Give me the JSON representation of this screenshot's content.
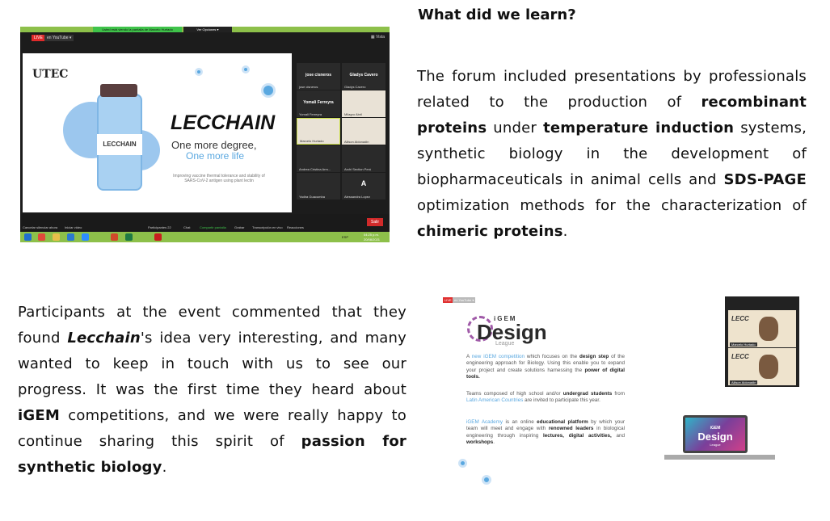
{
  "heading": "What did we learn?",
  "right_paragraph": {
    "parts": [
      "The forum included presentations by professionals related to the production of ",
      "recombinant proteins",
      " under ",
      "temperature induction",
      " systems, synthetic biology in the development of biopharmaceuticals in animal cells and ",
      "SDS-PAGE",
      " optimization methods for the characterization of ",
      "chimeric proteins",
      "."
    ]
  },
  "left_paragraph": {
    "parts": [
      "Participants at the event commented that they found ",
      "Lecchain",
      "'s idea very interesting, and many wanted to keep in touch with us to see our progress. It was the first time they heard about ",
      "iGEM",
      " competitions, and we were really happy to continue sharing this spirit of ",
      "passion for synthetic biology",
      "."
    ]
  },
  "zoom_screenshot": {
    "banner": "Usted está viendo la pantalla de Marcelo Hurtado",
    "options": "Ver Opciones ▾",
    "live": "LIVE",
    "youtube": "en YouTube ▾",
    "view": "▦ Vista",
    "slide": {
      "logo": "UTEC",
      "title": "LECCHAIN",
      "vial_label": "LECCHAIN",
      "tagline1": "One more degree,",
      "tagline2": "One more life",
      "subtitle": "Improving vaccine thermal tolerance and stability of SARS-CoV-2 antigen using plant lectin"
    },
    "participants": [
      {
        "name": "jose cisneros",
        "label": "jose cisneros",
        "video": false
      },
      {
        "name": "Gladys Cavero",
        "label": "Gladys Cavero",
        "video": false
      },
      {
        "name": "Yomali Ferreyra",
        "label": "Yomali Ferreyra",
        "video": false
      },
      {
        "name": "",
        "label": "Milagro Abril",
        "video": true
      },
      {
        "name": "",
        "label": "Marcelo Hurtado",
        "video": true
      },
      {
        "name": "",
        "label": "Allison Aldonadin",
        "video": true
      },
      {
        "name": "",
        "label": "Andrea Cristina Arm...",
        "video": true
      },
      {
        "name": "",
        "label": "Archi Section Perú",
        "video": true
      },
      {
        "name": "",
        "label": "Yadira Guacumba",
        "video": true
      },
      {
        "name": "A",
        "label": "Alessandra Lopez",
        "video": false
      }
    ],
    "toolbar": [
      "Cancelar silenciar ahora",
      "Iniciar video",
      "Participantes 22",
      "Chat",
      "Compartir pantalla",
      "Grabar",
      "Transcripción en vivo",
      "Reacciones"
    ],
    "leave": "Salir",
    "clock": "04:25 p.m.",
    "date": "20/08/2021",
    "lang": "ESP",
    "colors": {
      "taskbar": "#8dc04a",
      "share": "#3fc34a",
      "leave": "#d12a2a"
    }
  },
  "igem_screenshot": {
    "live": "LIVE",
    "youtube": "en YouTube ▾",
    "logo_top": "iGEM",
    "logo_main": "Design",
    "logo_sub": "League",
    "p1": [
      "A ",
      "new iGEM competition",
      " which focuses on the ",
      "design step",
      " of the engineering approach for Biology. Using this enable you to expand your project and create solutions harnessing the ",
      "power of digital tools."
    ],
    "p2": [
      "Teams composed of high school and/or ",
      "undergrad students",
      " from ",
      "Latin American Countries",
      " are invited to participate this year."
    ],
    "p3": [
      "iGEM Academy",
      " is an online ",
      "educational platform",
      " by which your team will meet and engage with ",
      "renowned leaders",
      " in biological engineering through inspiring ",
      "lectures, digital activities,",
      " and ",
      "workshops",
      "."
    ],
    "cam1": "Marcelo Hurtado",
    "cam2": "Allison Aldonadin",
    "cam_logo": "LECC",
    "laptop_top": "iGEM",
    "laptop_main": "Design",
    "laptop_sub": "League"
  }
}
